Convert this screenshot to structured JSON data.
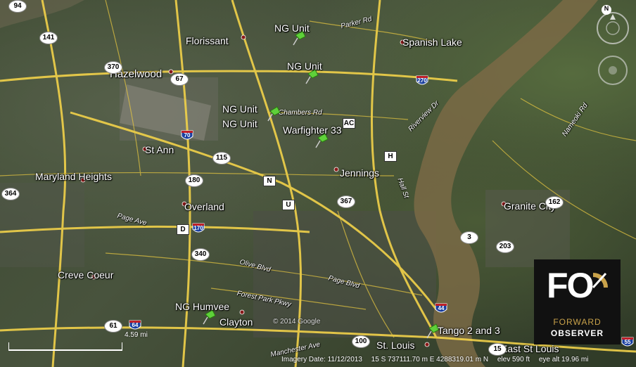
{
  "places": {
    "florissant": "Florissant",
    "spanish_lake": "Spanish Lake",
    "hazelwood": "Hazelwood",
    "st_ann": "St Ann",
    "maryland_heights": "Maryland Heights",
    "jennings": "Jennings",
    "overland": "Overland",
    "granite_city": "Granite City",
    "creve_coeur": "Creve Coeur",
    "clayton": "Clayton",
    "st_louis": "St. Louis",
    "east_st_louis": "East St Louis"
  },
  "markers": {
    "ng_unit_1": "NG Unit",
    "ng_unit_2": "NG Unit",
    "ng_unit_3": "NG Unit",
    "ng_unit_4": "NG Unit",
    "warfighter": "Warfighter 33",
    "humvee": "NG Humvee",
    "tango": "Tango 2 and 3"
  },
  "roads": {
    "parker": "Parker Rd",
    "chambers": "Chambers Rd",
    "riverview": "Riverview Dr",
    "hall": "Hall St",
    "page_west": "Page Ave",
    "olive": "Olive Blvd",
    "page_blvd": "Page Blvd",
    "forest_park": "Forest Park Pkwy",
    "manchester": "Manchester Ave",
    "nameoki": "Nameoki Rd"
  },
  "shields": {
    "s94": "94",
    "s141": "141",
    "s370": "370",
    "s67": "67",
    "s115": "115",
    "s180": "180",
    "s364": "364",
    "s367": "367",
    "s340": "340",
    "s3": "3",
    "s203": "203",
    "s162": "162",
    "s61": "61",
    "s100": "100",
    "s15": "15",
    "sq_ac": "AC",
    "sq_h": "H",
    "sq_n": "N",
    "sq_u": "U",
    "sq_d": "D"
  },
  "interstates": {
    "i270": "270",
    "i70": "70",
    "i170": "170",
    "i64": "64",
    "i44": "44",
    "i55": "55"
  },
  "copyright": "© 2014 Google",
  "status": {
    "imagery_date": "Imagery Date: 11/12/2013",
    "coords": "15 S 737111.70 m E 4288319.01 m N",
    "elev": "elev   590 ft",
    "eye_alt": "eye alt 19.96 mi"
  },
  "scale_label": "4.59 mi",
  "logo": {
    "mark": "FO",
    "line1": "FORWARD",
    "line2": "OBSERVER",
    "accent": "#c9a24a"
  },
  "nav": {
    "north": "N"
  },
  "colors": {
    "road": "#e8c840",
    "river": "#7a6a45",
    "highway": "#f2d24a",
    "pin": "#5fd13a"
  }
}
